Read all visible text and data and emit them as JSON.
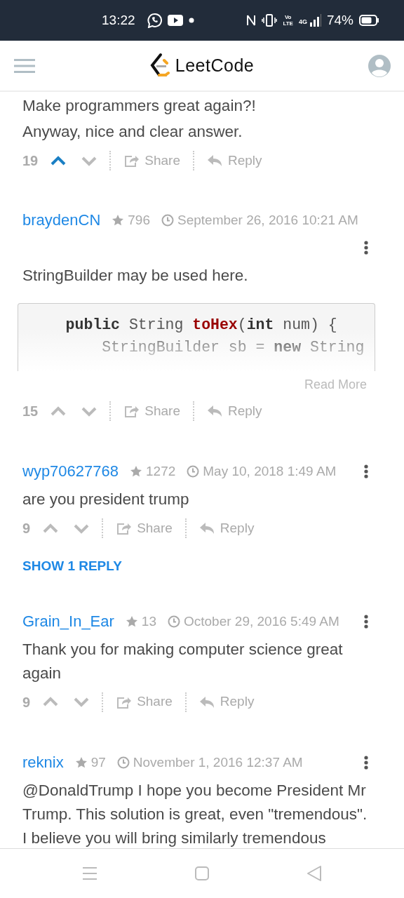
{
  "status_bar": {
    "time": "13:22",
    "volte": [
      "Vo",
      "LTE"
    ],
    "network": "4G",
    "battery": "74%"
  },
  "header": {
    "logo_text": "LeetCode"
  },
  "comments": [
    {
      "body": [
        {
          "kind": "text",
          "lines": [
            "Make programmers great again?!",
            "Anyway, nice and clear answer."
          ]
        }
      ],
      "votes": "19",
      "upvoted": true,
      "share": "Share",
      "reply": "Reply"
    },
    {
      "author": "braydenCN",
      "reputation": "796",
      "date": "September 26, 2016 10:21 AM",
      "body": [
        {
          "kind": "text",
          "lines": [
            "StringBuilder may be used here."
          ]
        },
        {
          "kind": "code",
          "lines": [
            [
              {
                "t": "    public",
                "kind": "keyword"
              },
              {
                "t": " String ",
                "kind": "plain"
              },
              {
                "t": "toHex",
                "kind": "function"
              },
              {
                "t": "(",
                "kind": "plain"
              },
              {
                "t": "int",
                "kind": "keyword"
              },
              {
                "t": " num) {",
                "kind": "plain"
              }
            ],
            [
              {
                "t": "        StringBuilder sb = ",
                "kind": "plain"
              },
              {
                "t": "new",
                "kind": "keyword"
              },
              {
                "t": " String",
                "kind": "plain"
              }
            ]
          ],
          "read_more": "Read More"
        }
      ],
      "votes": "15",
      "upvoted": false,
      "share": "Share",
      "reply": "Reply"
    },
    {
      "author": "wyp70627768",
      "reputation": "1272",
      "date": "May 10, 2018 1:49 AM",
      "body": [
        {
          "kind": "text",
          "lines": [
            "are you president trump"
          ]
        }
      ],
      "votes": "9",
      "upvoted": false,
      "share": "Share",
      "reply": "Reply",
      "show_replies": "SHOW 1 REPLY"
    },
    {
      "author": "Grain_In_Ear",
      "reputation": "13",
      "date": "October 29, 2016 5:49 AM",
      "body": [
        {
          "kind": "text",
          "lines": [
            "Thank you for making computer science great again"
          ]
        }
      ],
      "votes": "9",
      "upvoted": false,
      "share": "Share",
      "reply": "Reply"
    },
    {
      "author": "reknix",
      "reputation": "97",
      "date": "November 1, 2016 12:37 AM",
      "body": [
        {
          "kind": "text",
          "lines": [
            "@DonaldTrump I hope you become President Mr Trump. This solution is great, even \"tremendous\". I believe you will bring similarly tremendous"
          ]
        }
      ]
    }
  ]
}
